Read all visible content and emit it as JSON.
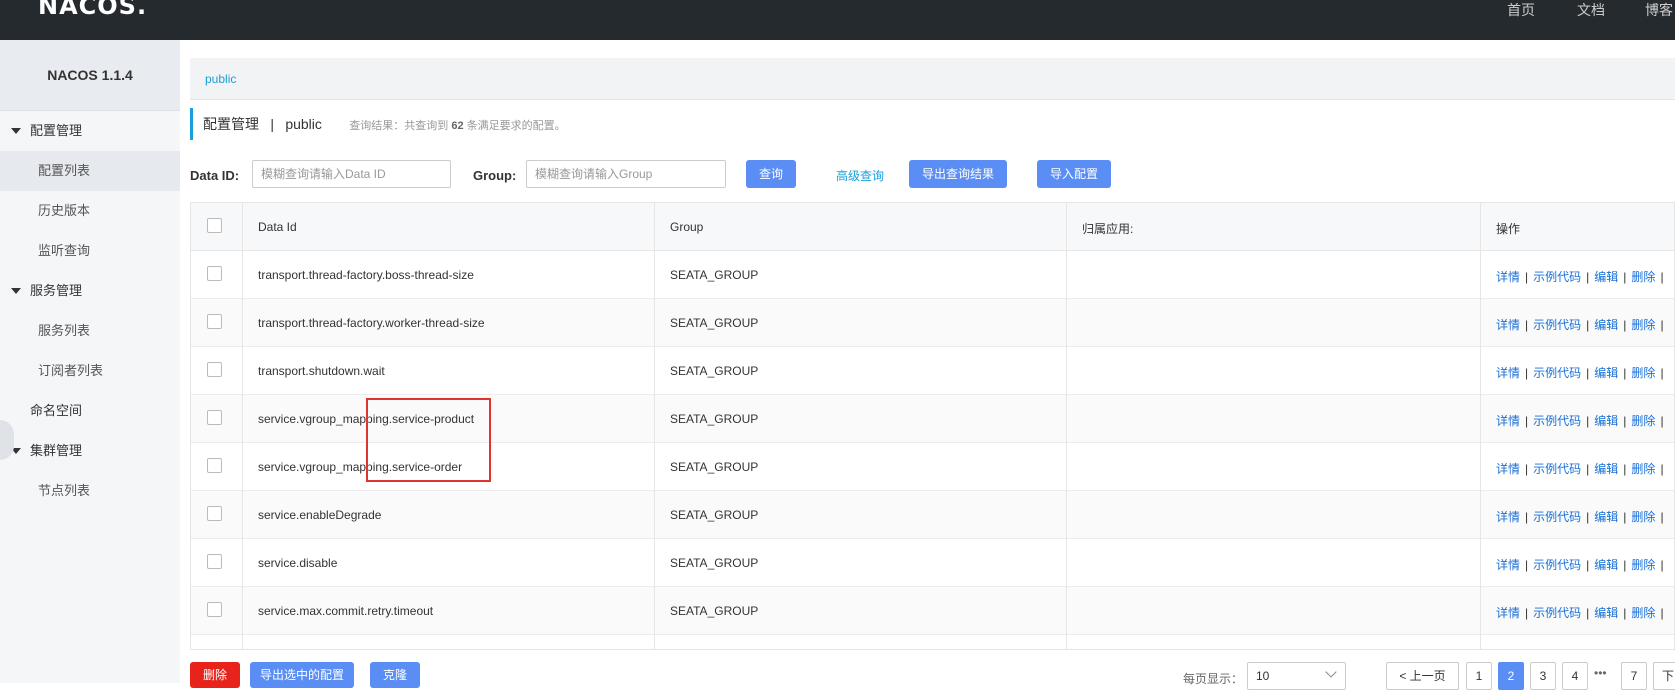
{
  "header": {
    "logo": "NACOS.",
    "nav": [
      "首页",
      "文档",
      "博客"
    ]
  },
  "sidebar": {
    "version": "NACOS 1.1.4",
    "groups": [
      {
        "label": "配置管理",
        "items": [
          "配置列表",
          "历史版本",
          "监听查询"
        ]
      },
      {
        "label": "服务管理",
        "items": [
          "服务列表",
          "订阅者列表"
        ]
      },
      {
        "label": "命名空间"
      },
      {
        "label": "集群管理",
        "items": [
          "节点列表"
        ]
      }
    ]
  },
  "breadcrumb": {
    "namespace": "public"
  },
  "page": {
    "title": "配置管理",
    "divider": "|",
    "namespace": "public",
    "result_prefix": "查询结果：共查询到",
    "result_count": "62",
    "result_suffix": "条满足要求的配置。"
  },
  "filters": {
    "dataid_label": "Data ID:",
    "dataid_placeholder": "模糊查询请输入Data ID",
    "group_label": "Group:",
    "group_placeholder": "模糊查询请输入Group",
    "search_button": "查询",
    "advanced_link": "高级查询",
    "export_button": "导出查询结果",
    "import_button": "导入配置"
  },
  "table": {
    "headers": [
      "Data Id",
      "Group",
      "归属应用:",
      "操作"
    ],
    "rows": [
      {
        "data_id": "transport.thread-factory.boss-thread-size",
        "group": "SEATA_GROUP",
        "app": ""
      },
      {
        "data_id": "transport.thread-factory.worker-thread-size",
        "group": "SEATA_GROUP",
        "app": ""
      },
      {
        "data_id": "transport.shutdown.wait",
        "group": "SEATA_GROUP",
        "app": ""
      },
      {
        "data_id": "service.vgroup_mapping.service-product",
        "group": "SEATA_GROUP",
        "app": ""
      },
      {
        "data_id": "service.vgroup_mapping.service-order",
        "group": "SEATA_GROUP",
        "app": ""
      },
      {
        "data_id": "service.enableDegrade",
        "group": "SEATA_GROUP",
        "app": ""
      },
      {
        "data_id": "service.disable",
        "group": "SEATA_GROUP",
        "app": ""
      },
      {
        "data_id": "service.max.commit.retry.timeout",
        "group": "SEATA_GROUP",
        "app": ""
      }
    ],
    "ops": [
      "详情",
      "示例代码",
      "编辑",
      "删除"
    ]
  },
  "footer": {
    "delete_button": "删除",
    "export_selected_button": "导出选中的配置",
    "clone_button": "克隆",
    "page_size_label": "每页显示：",
    "page_size": "10",
    "prev": "< 上一页",
    "pages": [
      "1",
      "2",
      "3",
      "4"
    ],
    "ellipsis": "•••",
    "last_page": "7",
    "next": "下"
  },
  "colors": {
    "accent": "#5a8ef5",
    "link": "#1a6fd8",
    "danger": "#e8231b",
    "highlight_box": "#e0322f"
  }
}
